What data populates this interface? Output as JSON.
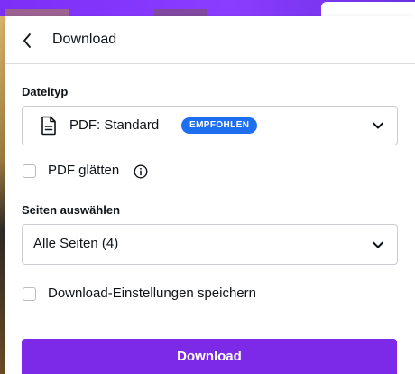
{
  "header": {
    "title": "Download"
  },
  "file_type": {
    "label": "Dateityp",
    "selected": "PDF: Standard",
    "badge": "EMPFOHLEN"
  },
  "flatten": {
    "label": "PDF glätten",
    "checked": false
  },
  "pages": {
    "label": "Seiten auswählen",
    "selected": "Alle Seiten (4)"
  },
  "save_settings": {
    "label": "Download-Einstellungen speichern",
    "checked": false
  },
  "download_button": {
    "label": "Download"
  },
  "colors": {
    "accent": "#7d2ae8",
    "badge": "#1e6ef0",
    "topbar": "#8b3dff"
  },
  "icons": {
    "back": "chevron-left-icon",
    "file": "document-icon",
    "info": "info-icon",
    "dropdown": "chevron-down-icon"
  }
}
